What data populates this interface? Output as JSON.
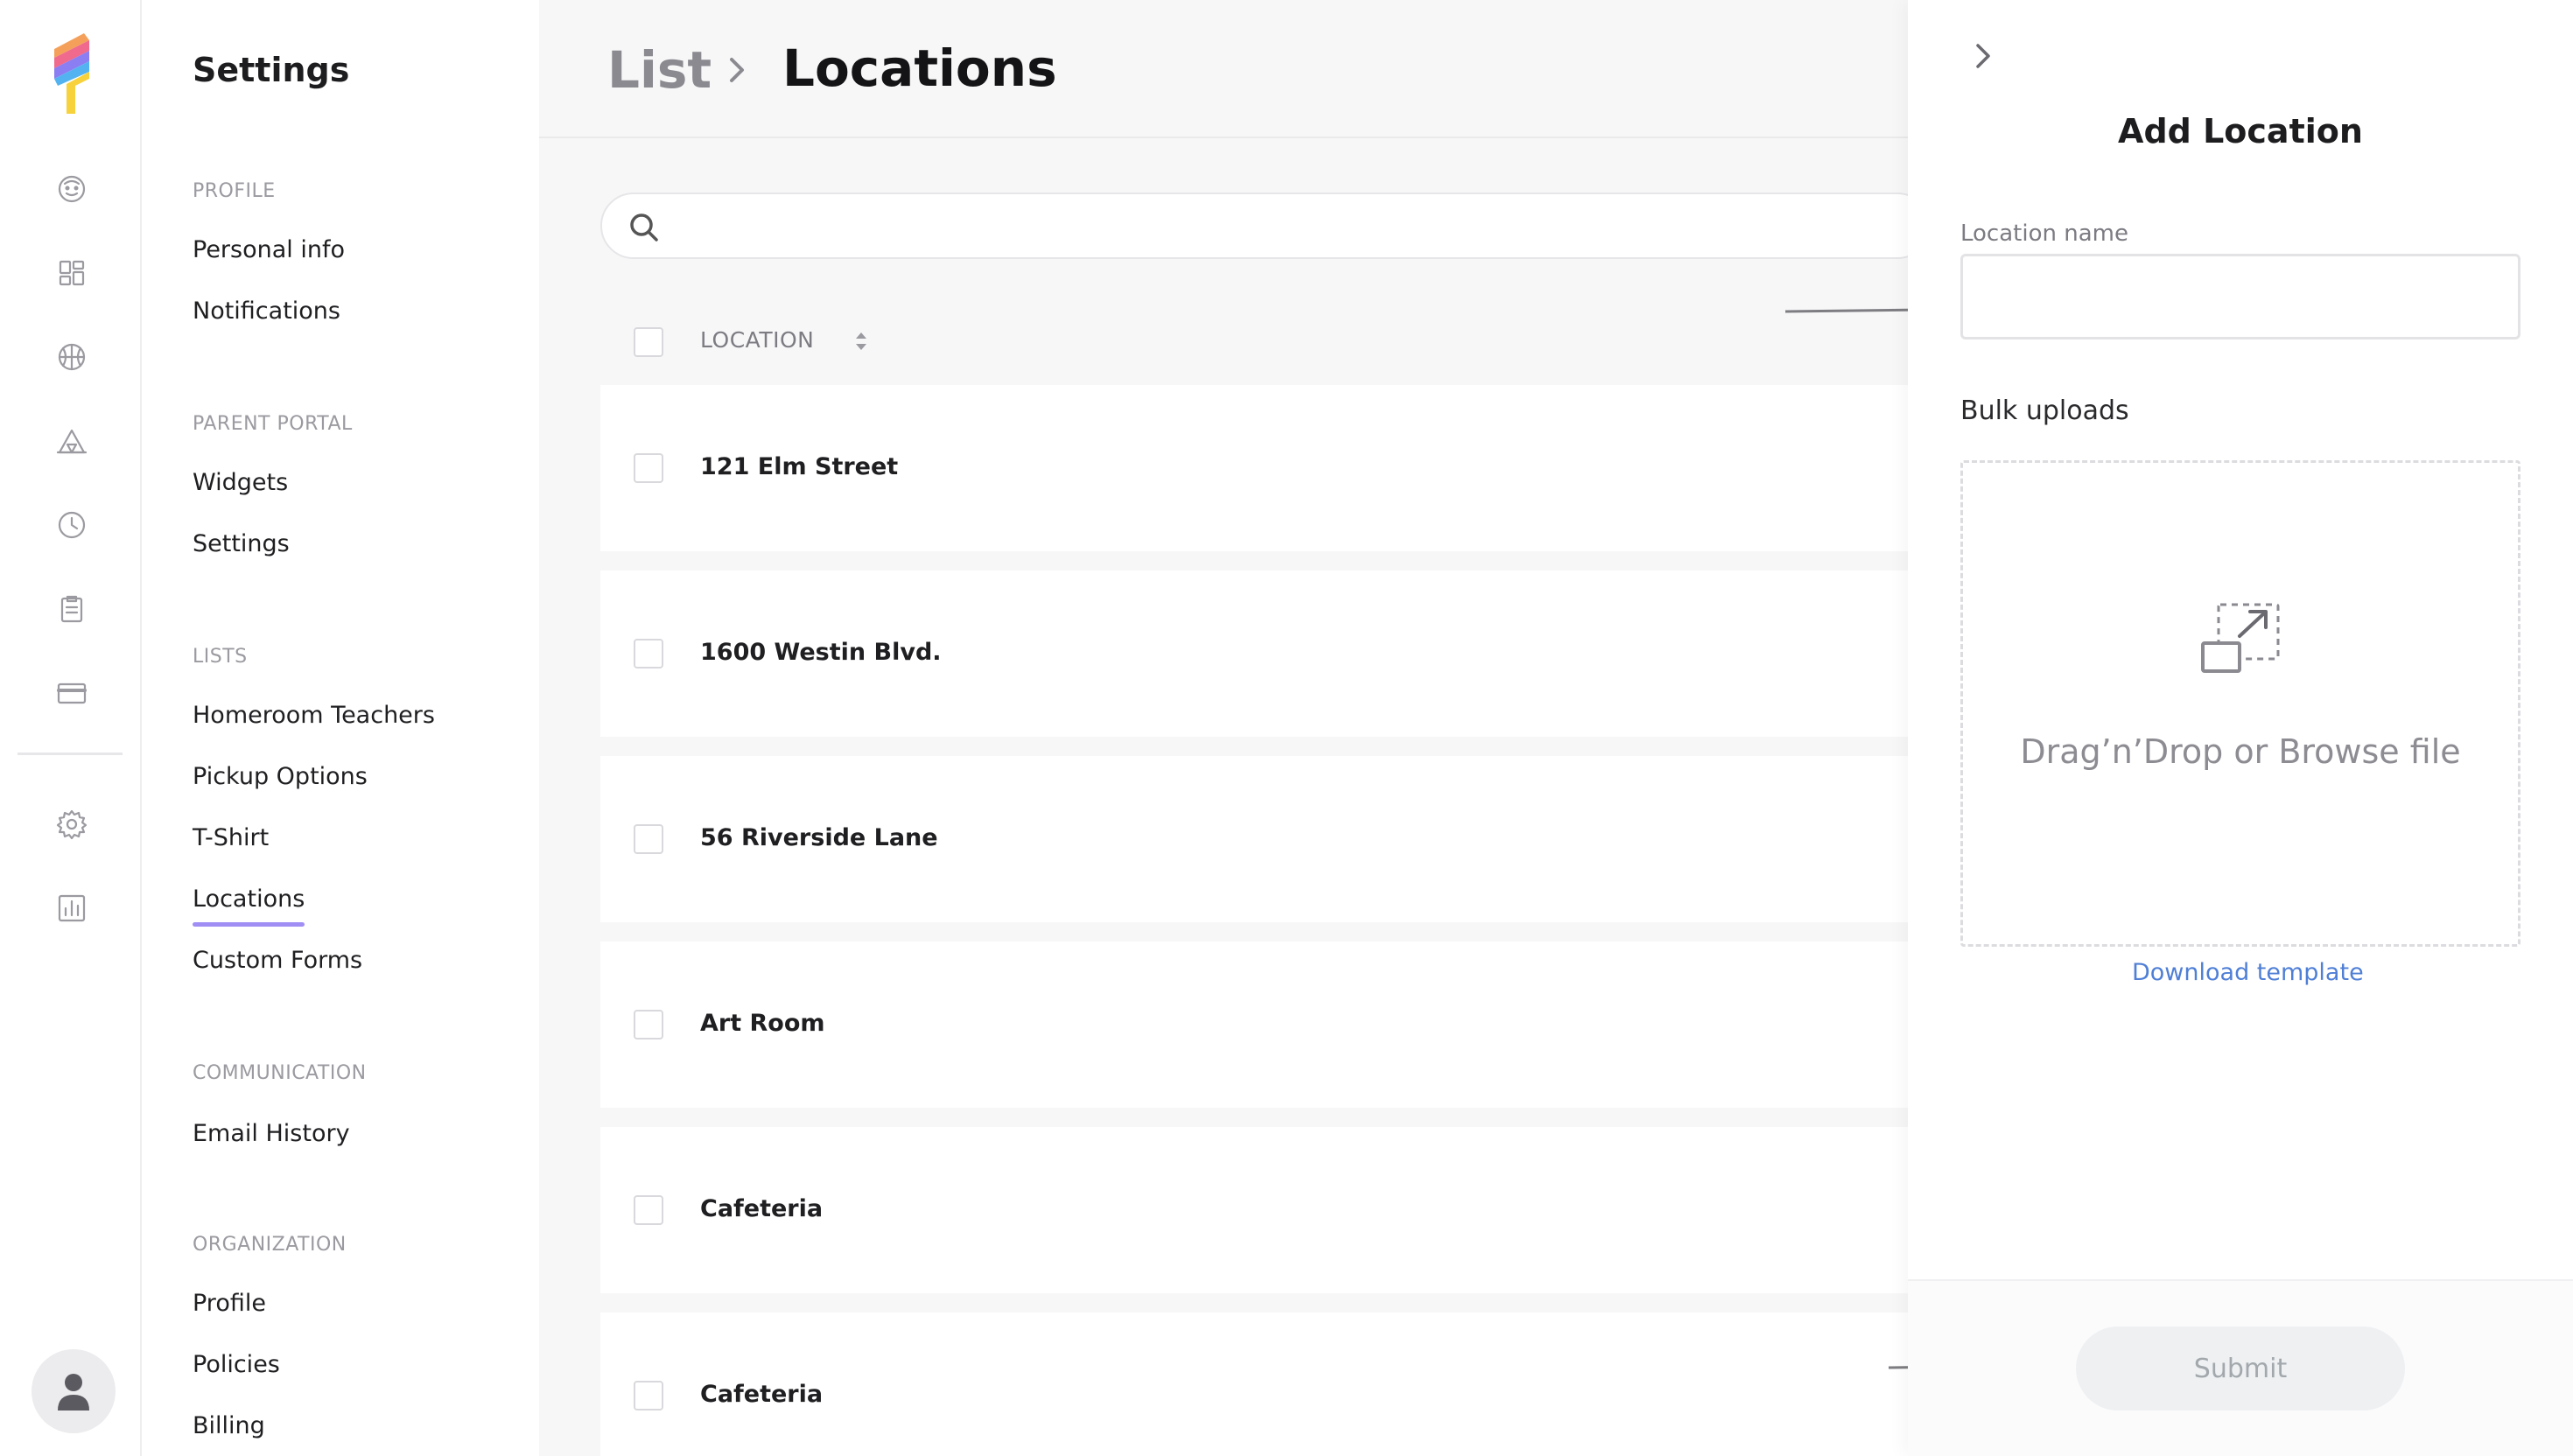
{
  "app": {
    "logo_icon": "popsicle-logo",
    "accent": "#a08ef5"
  },
  "rail": {
    "icons": [
      "face-icon",
      "dashboard-icon",
      "basketball-icon",
      "tent-icon",
      "clock-icon",
      "clipboard-icon",
      "credit-card-icon",
      "gear-icon",
      "bar-chart-icon"
    ],
    "avatar_icon": "user-icon"
  },
  "menu": {
    "title": "Settings",
    "sections": {
      "profile": {
        "label": "PROFILE",
        "items": [
          "Personal info",
          "Notifications"
        ]
      },
      "parent_portal": {
        "label": "PARENT PORTAL",
        "items": [
          "Widgets",
          "Settings"
        ]
      },
      "lists": {
        "label": "LISTS",
        "items": [
          "Homeroom Teachers",
          "Pickup Options",
          "T-Shirt",
          "Locations",
          "Custom Forms"
        ],
        "active": "Locations"
      },
      "communication": {
        "label": "COMMUNICATION",
        "items": [
          "Email History"
        ]
      },
      "organization": {
        "label": "ORGANIZATION",
        "items": [
          "Profile",
          "Policies",
          "Billing"
        ]
      }
    }
  },
  "breadcrumb": {
    "parent": "List",
    "current": "Locations"
  },
  "search": {
    "placeholder": "",
    "value": ""
  },
  "table": {
    "column_header": "LOCATION",
    "rows": [
      "121 Elm Street",
      "1600 Westin Blvd.",
      "56 Riverside Lane",
      "Art Room",
      "Cafeteria",
      "Cafeteria"
    ]
  },
  "drawer": {
    "title": "Add Location",
    "field_label": "Location name",
    "field_value": "",
    "bulk_label": "Bulk uploads",
    "drop_text": "Drag’n’Drop or Browse file",
    "download_link": "Download template",
    "submit_label": "Submit"
  }
}
